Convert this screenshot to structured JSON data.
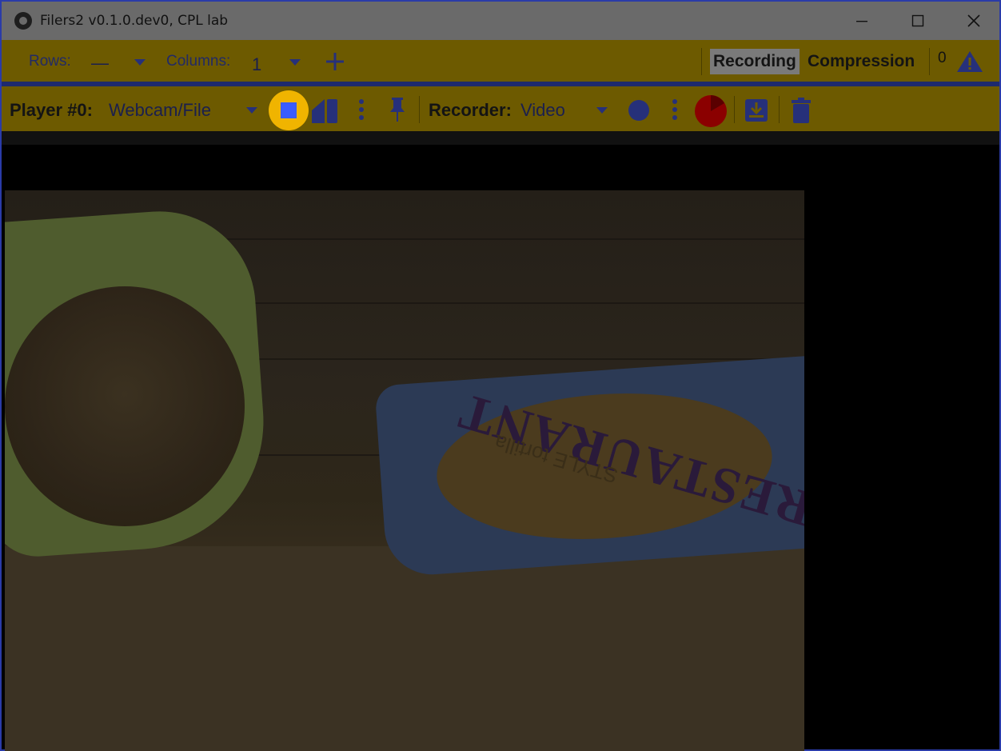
{
  "window": {
    "title": "Filers2 v0.1.0.dev0, CPL lab"
  },
  "toolbar": {
    "rows_label": "Rows:",
    "rows_value": "—",
    "columns_label": "Columns:",
    "columns_value": "1",
    "recording_tab": "Recording",
    "compression_tab": "Compression",
    "warning_count": "0"
  },
  "player_bar": {
    "player_label": "Player #0:",
    "player_source": "Webcam/File",
    "recorder_label": "Recorder:",
    "recorder_type": "Video"
  },
  "camera": {
    "bag_text": "RESTAURANT",
    "bag_subtext": "STYLE tortilla"
  },
  "colors": {
    "toolbar_bg": "#6d5a00",
    "accent": "#f0b400",
    "stop_square": "#3a5cff",
    "icon_blue": "#26307a",
    "record_dot": "#8b0000"
  }
}
